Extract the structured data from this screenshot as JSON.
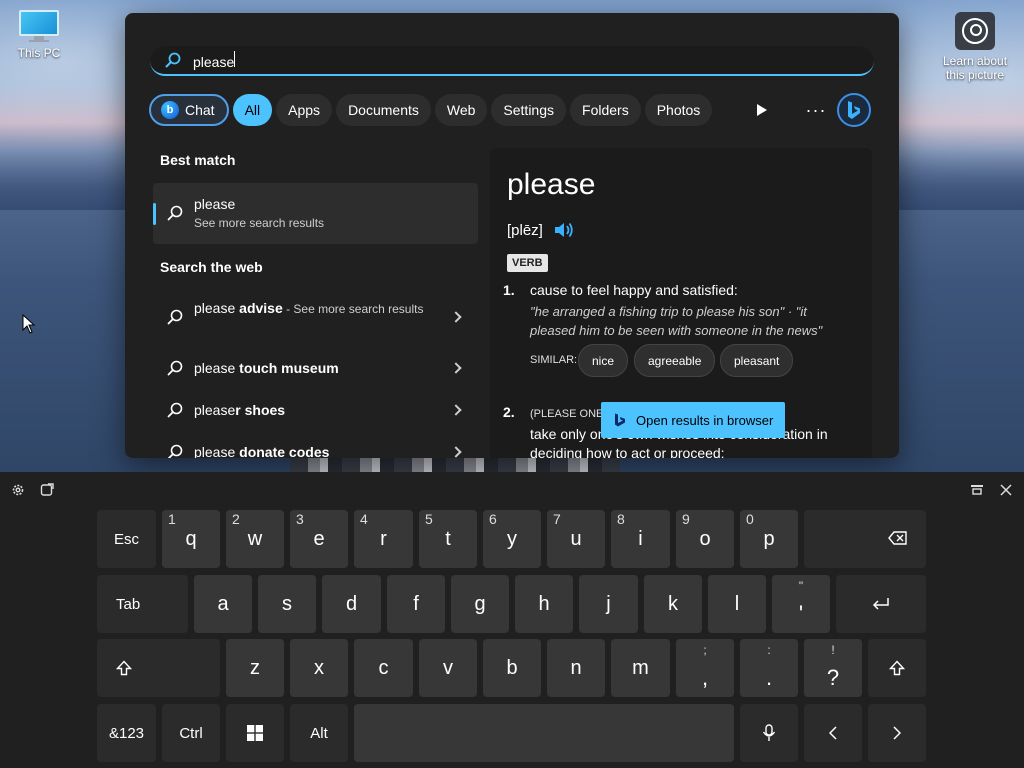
{
  "desktop": {
    "this_pc_label": "This PC",
    "learn_label": "Learn about this picture"
  },
  "search": {
    "query": "please"
  },
  "filters": {
    "chat": "Chat",
    "all": "All",
    "apps": "Apps",
    "documents": "Documents",
    "web": "Web",
    "settings": "Settings",
    "folders": "Folders",
    "photos": "Photos",
    "more": "···"
  },
  "left": {
    "best_match_title": "Best match",
    "best_match": {
      "title": "please",
      "subtitle": "See more search results"
    },
    "web_title": "Search the web",
    "web_items": [
      {
        "prefix": "please ",
        "bold": "advise",
        "suffix": " - See more search results"
      },
      {
        "prefix": "please ",
        "bold": "touch museum",
        "suffix": ""
      },
      {
        "prefix": "please",
        "bold": "r shoes",
        "suffix": ""
      },
      {
        "prefix": "please ",
        "bold": "donate codes",
        "suffix": ""
      }
    ]
  },
  "detail": {
    "word": "please",
    "phonetic": "[plēz]",
    "pos": "VERB",
    "def1_num": "1.",
    "def1": "cause to feel happy and satisfied:",
    "def1_example": "\"he arranged a fishing trip to please his son\" · \"it pleased him to be seen with someone in the news\"",
    "similar_label": "SIMILAR:",
    "synonyms": [
      "nice",
      "agreeable",
      "pleasant"
    ],
    "def2_num": "2.",
    "def2_label": "(PLEASE ONES",
    "def2": "take only one's own wishes into consideration in deciding how to act or proceed:",
    "open_browser": "Open results in browser"
  },
  "keyboard": {
    "row1": [
      {
        "num": "",
        "label": "Esc"
      },
      {
        "num": "1",
        "label": "q"
      },
      {
        "num": "2",
        "label": "w"
      },
      {
        "num": "3",
        "label": "e"
      },
      {
        "num": "4",
        "label": "r"
      },
      {
        "num": "5",
        "label": "t"
      },
      {
        "num": "6",
        "label": "y"
      },
      {
        "num": "7",
        "label": "u"
      },
      {
        "num": "8",
        "label": "i"
      },
      {
        "num": "9",
        "label": "o"
      },
      {
        "num": "0",
        "label": "p"
      }
    ],
    "row2": [
      "Tab",
      "a",
      "s",
      "d",
      "f",
      "g",
      "h",
      "j",
      "k",
      "l"
    ],
    "quote_sup": "\"",
    "quote_sub": "'",
    "row3": [
      "z",
      "x",
      "c",
      "v",
      "b",
      "n",
      "m"
    ],
    "semicolon_sup": ";",
    "semicolon_sub": ",",
    "colon_sup": ":",
    "colon_sub": ".",
    "excl_sup": "!",
    "excl_sub": "?",
    "sym_label": "&123",
    "ctrl_label": "Ctrl",
    "alt_label": "Alt"
  }
}
